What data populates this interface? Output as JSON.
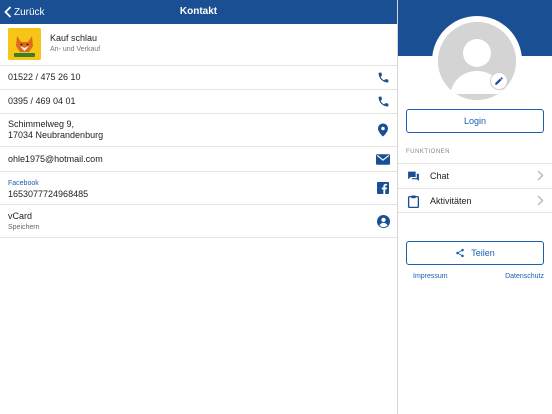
{
  "nav": {
    "back_label": "Zurück",
    "title": "Kontakt"
  },
  "shop": {
    "name": "Kauf schlau",
    "subtitle": "An- und Verkauf",
    "logo_icon": "fox-logo"
  },
  "contacts": {
    "phone1": {
      "value": "01522 / 475 26 10",
      "icon": "phone-icon"
    },
    "phone2": {
      "value": "0395 / 469 04 01",
      "icon": "phone-icon"
    },
    "address": {
      "line1": "Schimmelweg 9,",
      "line2": "17034 Neubrandenburg",
      "icon": "location-pin-icon"
    },
    "email": {
      "value": "ohle1975@hotmail.com",
      "icon": "mail-icon"
    },
    "facebook": {
      "label": "Facebook",
      "value": "1653077724968485",
      "icon": "facebook-icon"
    },
    "vcard": {
      "value": "vCard",
      "subtitle": "Speichern",
      "icon": "person-icon"
    }
  },
  "sidebar": {
    "login_label": "Login",
    "section_title": "FUNKTIONEN",
    "menu": [
      {
        "label": "Chat",
        "icon": "chat-icon"
      },
      {
        "label": "Aktivitäten",
        "icon": "clipboard-icon"
      }
    ],
    "share_label": "Teilen",
    "imprint_label": "Impressum",
    "privacy_label": "Datenschutz"
  },
  "colors": {
    "brand_blue": "#1b4f93",
    "accent_blue": "#1b5fb0",
    "logo_yellow": "#f7c518"
  }
}
